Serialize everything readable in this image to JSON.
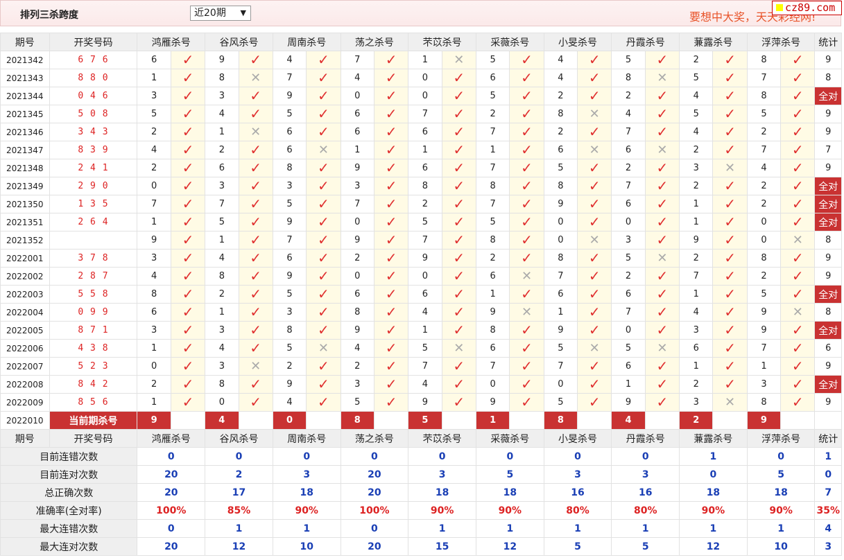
{
  "header": {
    "title": "排列三杀跨度",
    "period_select": "近20期",
    "slogan": "要想中大奖，天天彩经网!",
    "brand": "cz89.com"
  },
  "columns": {
    "issue": "期号",
    "draw": "开奖号码",
    "experts": [
      "鸿雁杀号",
      "谷风杀号",
      "周南杀号",
      "荡之杀号",
      "芣苡杀号",
      "采薇杀号",
      "小旻杀号",
      "丹霞杀号",
      "蒹露杀号",
      "浮萍杀号"
    ],
    "stat": "统计"
  },
  "rows": [
    {
      "issue": "2021342",
      "draw": "6 7 6",
      "cells": [
        [
          6,
          1
        ],
        [
          9,
          1
        ],
        [
          4,
          1
        ],
        [
          7,
          1
        ],
        [
          1,
          0
        ],
        [
          5,
          1
        ],
        [
          4,
          1
        ],
        [
          5,
          1
        ],
        [
          2,
          1
        ],
        [
          8,
          1
        ]
      ],
      "stat": "9"
    },
    {
      "issue": "2021343",
      "draw": "8 8 0",
      "cells": [
        [
          1,
          1
        ],
        [
          8,
          0
        ],
        [
          7,
          1
        ],
        [
          4,
          1
        ],
        [
          0,
          1
        ],
        [
          6,
          1
        ],
        [
          4,
          1
        ],
        [
          8,
          0
        ],
        [
          5,
          1
        ],
        [
          7,
          1
        ]
      ],
      "stat": "8"
    },
    {
      "issue": "2021344",
      "draw": "0 4 6",
      "cells": [
        [
          3,
          1
        ],
        [
          3,
          1
        ],
        [
          9,
          1
        ],
        [
          0,
          1
        ],
        [
          0,
          1
        ],
        [
          5,
          1
        ],
        [
          2,
          1
        ],
        [
          2,
          1
        ],
        [
          4,
          1
        ],
        [
          8,
          1
        ]
      ],
      "stat": "全对"
    },
    {
      "issue": "2021345",
      "draw": "5 0 8",
      "cells": [
        [
          5,
          1
        ],
        [
          4,
          1
        ],
        [
          5,
          1
        ],
        [
          6,
          1
        ],
        [
          7,
          1
        ],
        [
          2,
          1
        ],
        [
          8,
          0
        ],
        [
          4,
          1
        ],
        [
          5,
          1
        ],
        [
          5,
          1
        ]
      ],
      "stat": "9"
    },
    {
      "issue": "2021346",
      "draw": "3 4 3",
      "cells": [
        [
          2,
          1
        ],
        [
          1,
          0
        ],
        [
          6,
          1
        ],
        [
          6,
          1
        ],
        [
          6,
          1
        ],
        [
          7,
          1
        ],
        [
          2,
          1
        ],
        [
          7,
          1
        ],
        [
          4,
          1
        ],
        [
          2,
          1
        ]
      ],
      "stat": "9"
    },
    {
      "issue": "2021347",
      "draw": "8 3 9",
      "cells": [
        [
          4,
          1
        ],
        [
          2,
          1
        ],
        [
          6,
          0
        ],
        [
          1,
          1
        ],
        [
          1,
          1
        ],
        [
          1,
          1
        ],
        [
          6,
          0
        ],
        [
          6,
          0
        ],
        [
          2,
          1
        ],
        [
          7,
          1
        ]
      ],
      "stat": "7"
    },
    {
      "issue": "2021348",
      "draw": "2 4 1",
      "cells": [
        [
          2,
          1
        ],
        [
          6,
          1
        ],
        [
          8,
          1
        ],
        [
          9,
          1
        ],
        [
          6,
          1
        ],
        [
          7,
          1
        ],
        [
          5,
          1
        ],
        [
          2,
          1
        ],
        [
          3,
          0
        ],
        [
          4,
          1
        ]
      ],
      "stat": "9"
    },
    {
      "issue": "2021349",
      "draw": "2 9 0",
      "cells": [
        [
          0,
          1
        ],
        [
          3,
          1
        ],
        [
          3,
          1
        ],
        [
          3,
          1
        ],
        [
          8,
          1
        ],
        [
          8,
          1
        ],
        [
          8,
          1
        ],
        [
          7,
          1
        ],
        [
          2,
          1
        ],
        [
          2,
          1
        ]
      ],
      "stat": "全对"
    },
    {
      "issue": "2021350",
      "draw": "1 3 5",
      "cells": [
        [
          7,
          1
        ],
        [
          7,
          1
        ],
        [
          5,
          1
        ],
        [
          7,
          1
        ],
        [
          2,
          1
        ],
        [
          7,
          1
        ],
        [
          9,
          1
        ],
        [
          6,
          1
        ],
        [
          1,
          1
        ],
        [
          2,
          1
        ]
      ],
      "stat": "全对"
    },
    {
      "issue": "2021351",
      "draw": "2 6 4",
      "cells": [
        [
          1,
          1
        ],
        [
          5,
          1
        ],
        [
          9,
          1
        ],
        [
          0,
          1
        ],
        [
          5,
          1
        ],
        [
          5,
          1
        ],
        [
          0,
          1
        ],
        [
          0,
          1
        ],
        [
          1,
          1
        ],
        [
          0,
          1
        ]
      ],
      "stat": "全对"
    },
    {
      "issue": "2021352",
      "draw": "",
      "cells": [
        [
          9,
          1
        ],
        [
          1,
          1
        ],
        [
          7,
          1
        ],
        [
          9,
          1
        ],
        [
          7,
          1
        ],
        [
          8,
          1
        ],
        [
          0,
          0
        ],
        [
          3,
          1
        ],
        [
          9,
          1
        ],
        [
          0,
          0
        ]
      ],
      "stat": "8"
    },
    {
      "issue": "2022001",
      "draw": "3 7 8",
      "cells": [
        [
          3,
          1
        ],
        [
          4,
          1
        ],
        [
          6,
          1
        ],
        [
          2,
          1
        ],
        [
          9,
          1
        ],
        [
          2,
          1
        ],
        [
          8,
          1
        ],
        [
          5,
          0
        ],
        [
          2,
          1
        ],
        [
          8,
          1
        ]
      ],
      "stat": "9"
    },
    {
      "issue": "2022002",
      "draw": "2 8 7",
      "cells": [
        [
          4,
          1
        ],
        [
          8,
          1
        ],
        [
          9,
          1
        ],
        [
          0,
          1
        ],
        [
          0,
          1
        ],
        [
          6,
          0
        ],
        [
          7,
          1
        ],
        [
          2,
          1
        ],
        [
          7,
          1
        ],
        [
          2,
          1
        ]
      ],
      "stat": "9"
    },
    {
      "issue": "2022003",
      "draw": "5 5 8",
      "cells": [
        [
          8,
          1
        ],
        [
          2,
          1
        ],
        [
          5,
          1
        ],
        [
          6,
          1
        ],
        [
          6,
          1
        ],
        [
          1,
          1
        ],
        [
          6,
          1
        ],
        [
          6,
          1
        ],
        [
          1,
          1
        ],
        [
          5,
          1
        ]
      ],
      "stat": "全对"
    },
    {
      "issue": "2022004",
      "draw": "0 9 9",
      "cells": [
        [
          6,
          1
        ],
        [
          1,
          1
        ],
        [
          3,
          1
        ],
        [
          8,
          1
        ],
        [
          4,
          1
        ],
        [
          9,
          0
        ],
        [
          1,
          1
        ],
        [
          7,
          1
        ],
        [
          4,
          1
        ],
        [
          9,
          0
        ]
      ],
      "stat": "8"
    },
    {
      "issue": "2022005",
      "draw": "8 7 1",
      "cells": [
        [
          3,
          1
        ],
        [
          3,
          1
        ],
        [
          8,
          1
        ],
        [
          9,
          1
        ],
        [
          1,
          1
        ],
        [
          8,
          1
        ],
        [
          9,
          1
        ],
        [
          0,
          1
        ],
        [
          3,
          1
        ],
        [
          9,
          1
        ]
      ],
      "stat": "全对"
    },
    {
      "issue": "2022006",
      "draw": "4 3 8",
      "cells": [
        [
          1,
          1
        ],
        [
          4,
          1
        ],
        [
          5,
          0
        ],
        [
          4,
          1
        ],
        [
          5,
          0
        ],
        [
          6,
          1
        ],
        [
          5,
          0
        ],
        [
          5,
          0
        ],
        [
          6,
          1
        ],
        [
          7,
          1
        ]
      ],
      "stat": "6"
    },
    {
      "issue": "2022007",
      "draw": "5 2 3",
      "cells": [
        [
          0,
          1
        ],
        [
          3,
          0
        ],
        [
          2,
          1
        ],
        [
          2,
          1
        ],
        [
          7,
          1
        ],
        [
          7,
          1
        ],
        [
          7,
          1
        ],
        [
          6,
          1
        ],
        [
          1,
          1
        ],
        [
          1,
          1
        ]
      ],
      "stat": "9"
    },
    {
      "issue": "2022008",
      "draw": "8 4 2",
      "cells": [
        [
          2,
          1
        ],
        [
          8,
          1
        ],
        [
          9,
          1
        ],
        [
          3,
          1
        ],
        [
          4,
          1
        ],
        [
          0,
          1
        ],
        [
          0,
          1
        ],
        [
          1,
          1
        ],
        [
          2,
          1
        ],
        [
          3,
          1
        ]
      ],
      "stat": "全对"
    },
    {
      "issue": "2022009",
      "draw": "8 5 6",
      "cells": [
        [
          1,
          1
        ],
        [
          0,
          1
        ],
        [
          4,
          1
        ],
        [
          5,
          1
        ],
        [
          9,
          1
        ],
        [
          9,
          1
        ],
        [
          5,
          1
        ],
        [
          9,
          1
        ],
        [
          3,
          0
        ],
        [
          8,
          1
        ]
      ],
      "stat": "9"
    }
  ],
  "current": {
    "issue": "2022010",
    "label": "当前期杀号",
    "kills": [
      "9",
      "4",
      "0",
      "8",
      "5",
      "1",
      "8",
      "4",
      "2",
      "9"
    ]
  },
  "summary": [
    {
      "label": "目前连错次数",
      "values": [
        "0",
        "0",
        "0",
        "0",
        "0",
        "0",
        "0",
        "0",
        "1",
        "0"
      ],
      "stat": "1",
      "style": "blue"
    },
    {
      "label": "目前连对次数",
      "values": [
        "20",
        "2",
        "3",
        "20",
        "3",
        "5",
        "3",
        "3",
        "0",
        "5"
      ],
      "stat": "0",
      "style": "blue"
    },
    {
      "label": "总正确次数",
      "values": [
        "20",
        "17",
        "18",
        "20",
        "18",
        "18",
        "16",
        "16",
        "18",
        "18"
      ],
      "stat": "7",
      "style": "blue"
    },
    {
      "label": "准确率(全对率)",
      "values": [
        "100%",
        "85%",
        "90%",
        "100%",
        "90%",
        "90%",
        "80%",
        "80%",
        "90%",
        "90%"
      ],
      "stat": "35%",
      "style": "red"
    },
    {
      "label": "最大连错次数",
      "values": [
        "0",
        "1",
        "1",
        "0",
        "1",
        "1",
        "1",
        "1",
        "1",
        "1"
      ],
      "stat": "4",
      "style": "blue"
    },
    {
      "label": "最大连对次数",
      "values": [
        "20",
        "12",
        "10",
        "20",
        "15",
        "12",
        "5",
        "5",
        "12",
        "10"
      ],
      "stat": "3",
      "style": "blue"
    }
  ],
  "icons": {
    "correct": "check-icon",
    "wrong": "cross-icon"
  },
  "colors": {
    "correct": "#e03030",
    "wrong": "#aaaaaa",
    "highlight": "#c93232",
    "blue": "#1a3fb5"
  }
}
